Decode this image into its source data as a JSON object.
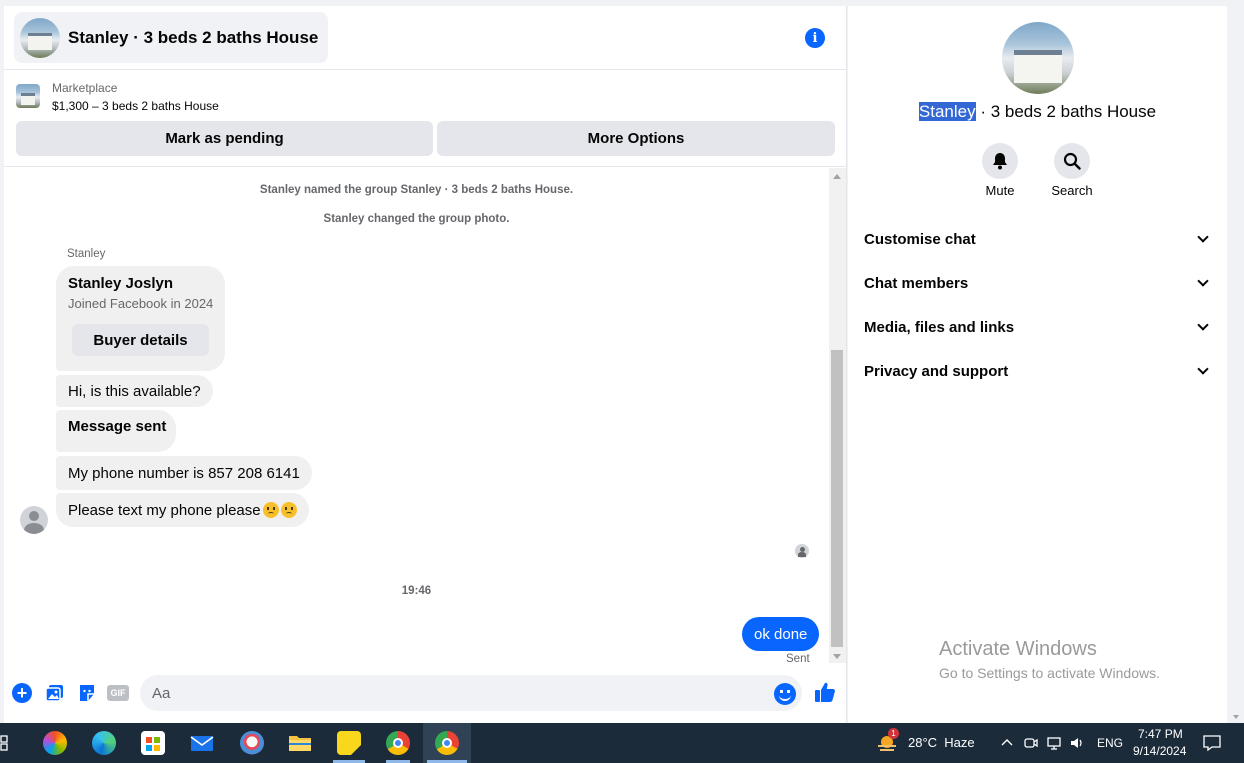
{
  "chat": {
    "title": "Stanley · 3 beds 2 baths House",
    "marketplace": {
      "label": "Marketplace",
      "listing": "$1,300 – 3 beds 2 baths House",
      "mark_pending": "Mark as pending",
      "more_options": "More Options"
    },
    "system_messages": [
      "Stanley named the group Stanley · 3 beds 2 baths House.",
      "Stanley changed the group photo."
    ],
    "sender": "Stanley",
    "profile_card": {
      "name": "Stanley Joslyn",
      "subtitle": "Joined Facebook in 2024",
      "button": "Buyer details"
    },
    "messages": [
      "Hi, is this available?",
      "Message sent",
      "My phone number is 857 208 6141",
      "Please text my phone please"
    ],
    "timestamp": "19:46",
    "my_message": "ok done",
    "status": "Sent",
    "composer_placeholder": "Aa",
    "gif_label": "GIF"
  },
  "details": {
    "name_highlight": "Stanley",
    "name_rest": " · 3 beds 2 baths House",
    "actions": [
      "Mute",
      "Search"
    ],
    "sections": [
      "Customise chat",
      "Chat members",
      "Media, files and links",
      "Privacy and support"
    ]
  },
  "watermark": {
    "line1": "Activate Windows",
    "line2": "Go to Settings to activate Windows."
  },
  "taskbar": {
    "weather": "28°C  Haze",
    "weather_badge": "1",
    "language": "ENG",
    "time": "7:47 PM",
    "date": "9/14/2024"
  },
  "colors": {
    "accent": "#0866ff",
    "bubble_gray": "#f0f0f0",
    "taskbar": "#1c2b3a"
  }
}
